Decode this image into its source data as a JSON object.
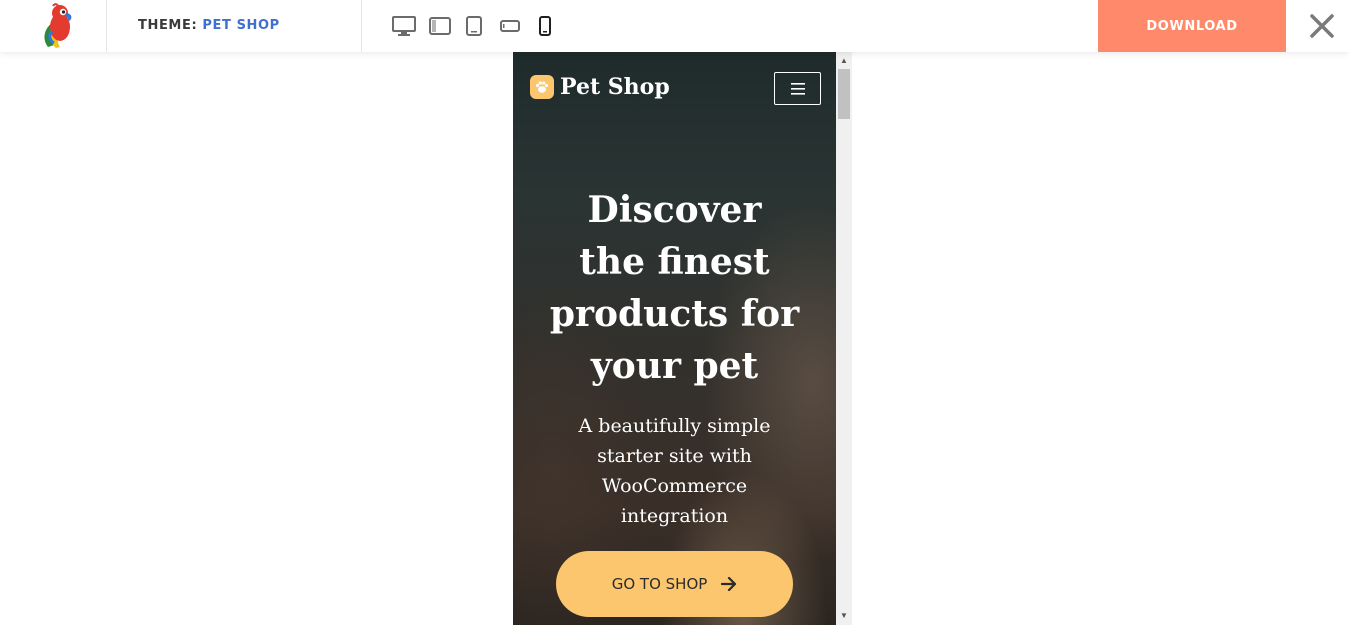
{
  "topbar": {
    "theme_prefix": "THEME:",
    "theme_name": "PET SHOP",
    "download_label": "DOWNLOAD",
    "devices": [
      {
        "name": "desktop-icon",
        "active": false
      },
      {
        "name": "laptop-icon",
        "active": false
      },
      {
        "name": "tablet-icon",
        "active": false
      },
      {
        "name": "tablet-landscape-icon",
        "active": false
      },
      {
        "name": "mobile-icon",
        "active": true
      }
    ],
    "close_icon": "close-icon",
    "logo_icon": "parrot-logo-icon"
  },
  "site": {
    "brand": "Pet Shop",
    "menu_icon": "hamburger-menu-icon",
    "hero": {
      "title_lines": [
        "Discover",
        "the finest",
        "products for",
        "your pet"
      ],
      "subtitle_lines": [
        "A beautifully simple",
        "starter site with",
        "WooCommerce",
        "integration"
      ],
      "cta_label": "GO TO SHOP",
      "cta_icon": "arrow-right-icon"
    }
  },
  "colors": {
    "download_bg": "#ff8a6b",
    "theme_name": "#3f6fd1",
    "cta_bg": "#fbc66e"
  }
}
